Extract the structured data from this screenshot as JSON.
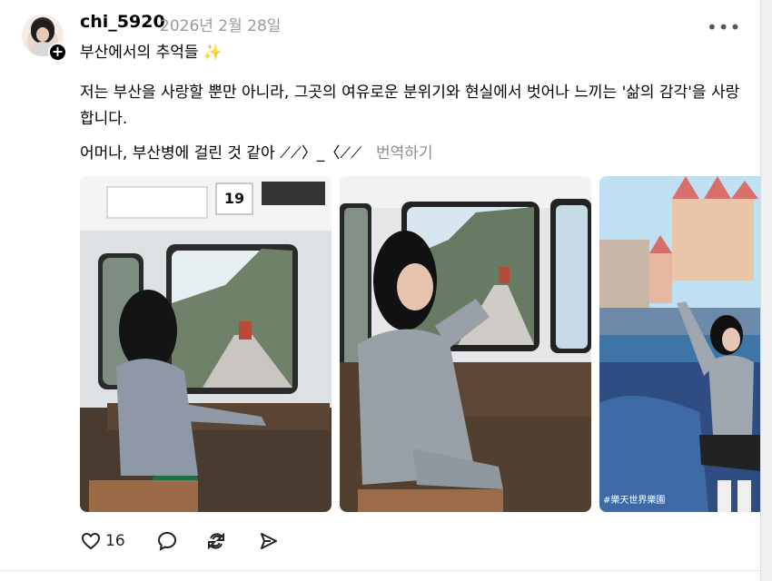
{
  "post": {
    "username": "chi_5920",
    "date": "2026년 2월 28일",
    "caption": "부산에서의 추억들 ✨",
    "body": "저는 부산을 사랑할 뿐만 아니라, 그곳의 여유로운 분위기와 현실에서 벗어나 느끼는 '삶의 감각'을 사랑합니다.",
    "second_line": "어머나, 부산병에 걸린 것 같아 ⟋⟋〉_〈⟋⟋",
    "translate_label": "번역하기",
    "photos": [
      {
        "name": "photo-1",
        "overlay_text": "19"
      },
      {
        "name": "photo-2"
      },
      {
        "name": "photo-3",
        "watermark": "#樂天世界樂園"
      }
    ],
    "stats": {
      "likes": "16"
    },
    "icons": [
      "heart-icon",
      "comment-icon",
      "repost-icon",
      "share-icon",
      "more-icon",
      "follow-plus-icon",
      "sparkle-icon"
    ]
  }
}
